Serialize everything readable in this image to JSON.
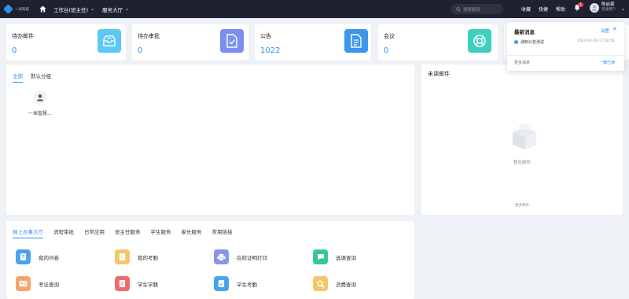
{
  "header": {
    "logo_text": "一米科技",
    "nav": [
      {
        "label": "工作台(班主任)"
      },
      {
        "label": "服务大厅"
      }
    ],
    "search_placeholder": "搜索服务",
    "links": [
      "收藏",
      "快捷",
      "帮助"
    ],
    "notification_count": "1",
    "user_name": "陈启豪",
    "user_role": "普通用户"
  },
  "stats": [
    {
      "title": "待办邮件",
      "value": "0",
      "color": "#5cc9f5",
      "icon": "inbox-icon"
    },
    {
      "title": "待办审批",
      "value": "0",
      "color": "#7b8ff0",
      "icon": "approval-doc-icon"
    },
    {
      "title": "公告",
      "value": "1022",
      "color": "#3c96ee",
      "icon": "document-icon"
    },
    {
      "title": "会议",
      "value": "0",
      "color": "#3fcfc0",
      "icon": "lifebuoy-icon"
    }
  ],
  "contacts": {
    "tabs": [
      "全部",
      "默认分组"
    ],
    "items": [
      {
        "name": "一米智慧…"
      }
    ]
  },
  "mail": {
    "title": "未读邮件",
    "empty_text": "暂无邮件",
    "more_text": "更多邮件"
  },
  "services": {
    "tabs": [
      "网上办事大厅",
      "流程审批",
      "日常应用",
      "班主任服务",
      "学生服务",
      "家长服务",
      "常用链接"
    ],
    "items": [
      {
        "label": "我的问卷",
        "color": "#4aa3f0",
        "icon": "questionnaire-icon"
      },
      {
        "label": "我的考勤",
        "color": "#f5c56b",
        "icon": "attendance-icon"
      },
      {
        "label": "在校证明打印",
        "color": "#8a94e8",
        "icon": "printer-icon"
      },
      {
        "label": "选课查询",
        "color": "#35c98f",
        "icon": "course-query-icon"
      },
      {
        "label": "考证查询",
        "color": "#f5a46b",
        "icon": "certificate-icon"
      },
      {
        "label": "学生学籍",
        "color": "#ef6b6b",
        "icon": "student-record-icon"
      },
      {
        "label": "学生考勤",
        "color": "#4aa3f0",
        "icon": "student-attendance-icon"
      },
      {
        "label": "消费查询",
        "color": "#f5c56b",
        "icon": "consumption-search-icon"
      }
    ]
  },
  "notifications": {
    "title": "最新消息",
    "settings": "设置",
    "items": [
      {
        "text": "通知公告测试",
        "time": "2024-04-29 17:00:56"
      }
    ],
    "more": "更多消息",
    "read_all": "一键已读"
  }
}
